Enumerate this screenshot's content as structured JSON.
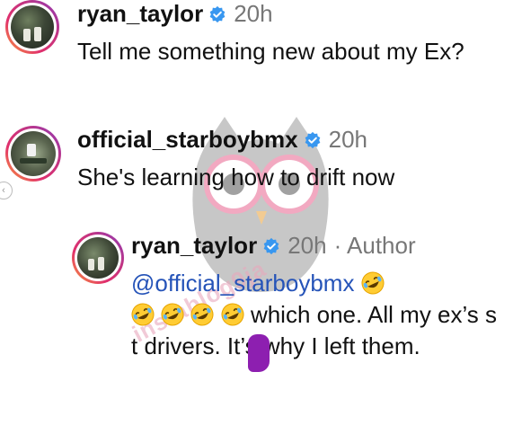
{
  "comments": [
    {
      "username": "ryan_taylor",
      "time": "20h",
      "text": "Tell me something new about my Ex?"
    },
    {
      "username": "official_starboybmx",
      "time": "20h",
      "text": "She's learning how to drift now"
    }
  ],
  "reply": {
    "username": "ryan_taylor",
    "time": "20h",
    "author_label": "· Author",
    "mention": "@official_starboybmx",
    "text_after_emojis": "which one. All",
    "text_rest": "my ex’s s  t drivers. It’s why I left them."
  },
  "watermark": {
    "text": "instablog9ja"
  },
  "icons": {
    "verified": "verified-badge-icon",
    "emoji": "rolling-on-floor-laughing-emoji"
  },
  "colors": {
    "verified_blue": "#3897f0",
    "mention_blue": "#2553b8",
    "censor_purple": "#8d1fb0",
    "watermark_pink": "#e9a8bd"
  }
}
